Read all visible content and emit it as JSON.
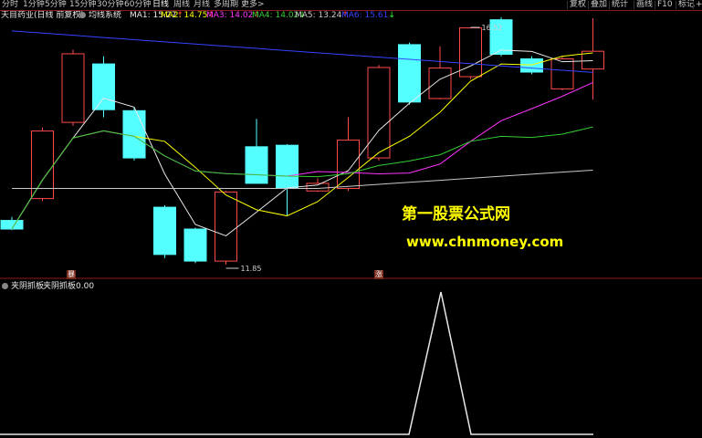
{
  "toolbar": {
    "periods": [
      "分时",
      "1分钟",
      "5分钟",
      "15分钟",
      "30分钟",
      "60分钟",
      "日线",
      "周线",
      "月线",
      "多周期",
      "更多"
    ],
    "active_period": "日线",
    "more_arrow": ">",
    "right_buttons": [
      "复权",
      "叠加",
      "统计",
      "画线",
      "F10",
      "标记",
      "+自"
    ]
  },
  "main_chart": {
    "stock_name": "天目药业(日线 前复权)",
    "indicator_name": "均线系统",
    "ma": [
      {
        "label": "MA1: 15.27",
        "arrow": "↑",
        "color": "#e8e8e8"
      },
      {
        "label": "MA2: 14.75",
        "arrow": "↑",
        "color": "#ffff00"
      },
      {
        "label": "MA3: 14.02",
        "arrow": "↑",
        "color": "#ff33ff"
      },
      {
        "label": "MA4: 14.02",
        "arrow": "↓",
        "color": "#33cc33"
      },
      {
        "label": "MA5: 13.24",
        "arrow": "↑",
        "color": "#c8c8c8"
      },
      {
        "label": "MA6: 15.61",
        "arrow": "↓",
        "color": "#3344ff"
      }
    ],
    "high_label": "16.52",
    "low_label": "11.85",
    "marks": [
      "暴",
      "涨"
    ],
    "candles": [
      {
        "o": 12.72,
        "c": 12.55,
        "h": 12.79,
        "l": 12.53
      },
      {
        "o": 13.15,
        "c": 14.48,
        "h": 14.55,
        "l": 13.1
      },
      {
        "o": 14.65,
        "c": 16.0,
        "h": 16.08,
        "l": 14.58
      },
      {
        "o": 15.8,
        "c": 14.9,
        "h": 15.95,
        "l": 14.75
      },
      {
        "o": 14.88,
        "c": 13.95,
        "h": 14.94,
        "l": 13.9
      },
      {
        "o": 12.98,
        "c": 12.05,
        "h": 13.02,
        "l": 11.98
      },
      {
        "o": 12.55,
        "c": 11.92,
        "h": 12.58,
        "l": 11.88
      },
      {
        "o": 11.92,
        "c": 13.28,
        "h": 13.3,
        "l": 11.85
      },
      {
        "o": 14.17,
        "c": 13.45,
        "h": 14.72,
        "l": 13.45
      },
      {
        "o": 14.2,
        "c": 13.35,
        "h": 14.22,
        "l": 12.8
      },
      {
        "o": 13.3,
        "c": 13.45,
        "h": 13.55,
        "l": 13.28
      },
      {
        "o": 13.35,
        "c": 14.3,
        "h": 14.75,
        "l": 13.3
      },
      {
        "o": 13.95,
        "c": 15.73,
        "h": 15.78,
        "l": 13.9
      },
      {
        "o": 16.18,
        "c": 15.05,
        "h": 16.22,
        "l": 15.0
      },
      {
        "o": 15.12,
        "c": 15.72,
        "h": 16.15,
        "l": 15.1
      },
      {
        "o": 15.55,
        "c": 16.51,
        "h": 16.52,
        "l": 15.5
      },
      {
        "o": 16.67,
        "c": 15.99,
        "h": 16.72,
        "l": 15.95
      },
      {
        "o": 15.9,
        "c": 15.64,
        "h": 15.95,
        "l": 15.6
      },
      {
        "o": 15.31,
        "c": 15.9,
        "h": 15.95,
        "l": 15.28
      },
      {
        "o": 15.7,
        "c": 16.05,
        "h": 16.7,
        "l": 15.1
      }
    ]
  },
  "sub_chart": {
    "indicator_name": "夹阴抓板",
    "value_label": "夹阴抓板",
    "value": "0.00"
  },
  "watermark": {
    "line1": "第一股票公式网",
    "line2": "www.chnmoney.com"
  }
}
